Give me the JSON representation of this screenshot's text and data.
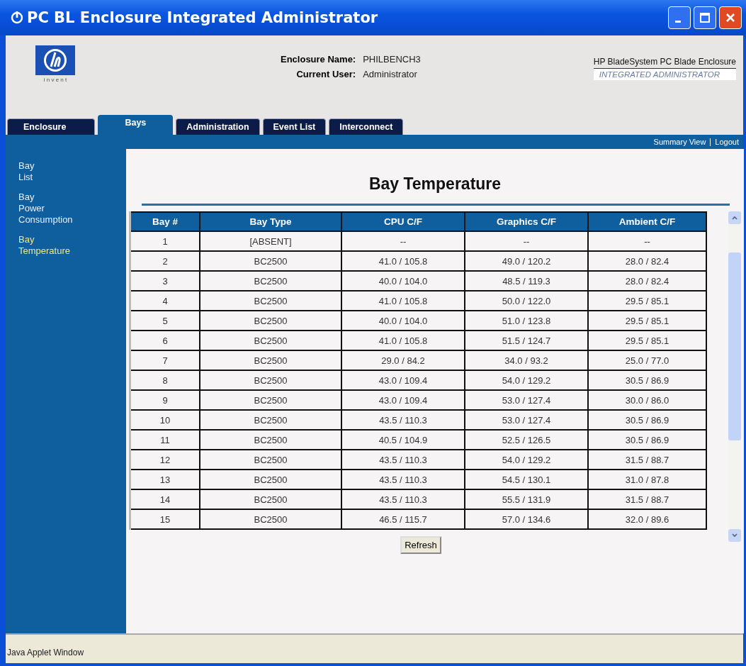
{
  "window": {
    "title": "PC BL Enclosure Integrated Administrator"
  },
  "header": {
    "fields": [
      {
        "label": "Enclosure Name:",
        "value": "PHILBENCH3"
      },
      {
        "label": "Current User:",
        "value": "Administrator"
      }
    ],
    "product_line_1": "HP BladeSystem PC Blade Enclosure",
    "product_line_2": "INTEGRATED ADMINISTRATOR",
    "logo_tagline": "i n v e n t"
  },
  "tabs": [
    {
      "label": "Enclosure",
      "selected": false
    },
    {
      "label": "Bays",
      "selected": true
    },
    {
      "label": "Administration",
      "selected": false
    },
    {
      "label": "Event List",
      "selected": false
    },
    {
      "label": "Interconnect",
      "selected": false
    }
  ],
  "top_links": [
    "Summary View",
    "Logout"
  ],
  "sidebar": {
    "items": [
      {
        "label": "Bay List",
        "selected": false
      },
      {
        "label": "Bay Power Consumption",
        "selected": false
      },
      {
        "label": "Bay Temperature",
        "selected": true
      }
    ]
  },
  "page_title": "Bay Temperature",
  "table": {
    "columns": [
      "Bay #",
      "Bay Type",
      "CPU C/F",
      "Graphics C/F",
      "Ambient C/F"
    ],
    "rows": [
      [
        "1",
        "[ABSENT]",
        "--",
        "--",
        "--"
      ],
      [
        "2",
        "BC2500",
        "41.0 / 105.8",
        "49.0 / 120.2",
        "28.0 / 82.4"
      ],
      [
        "3",
        "BC2500",
        "40.0 / 104.0",
        "48.5 / 119.3",
        "28.0 / 82.4"
      ],
      [
        "4",
        "BC2500",
        "41.0 / 105.8",
        "50.0 / 122.0",
        "29.5 / 85.1"
      ],
      [
        "5",
        "BC2500",
        "40.0 / 104.0",
        "51.0 / 123.8",
        "29.5 / 85.1"
      ],
      [
        "6",
        "BC2500",
        "41.0 / 105.8",
        "51.5 / 124.7",
        "29.5 / 85.1"
      ],
      [
        "7",
        "BC2500",
        "29.0 / 84.2",
        "34.0 / 93.2",
        "25.0 / 77.0"
      ],
      [
        "8",
        "BC2500",
        "43.0 / 109.4",
        "54.0 / 129.2",
        "30.5 / 86.9"
      ],
      [
        "9",
        "BC2500",
        "43.0 / 109.4",
        "53.0 / 127.4",
        "30.0 / 86.0"
      ],
      [
        "10",
        "BC2500",
        "43.5 / 110.3",
        "53.0 / 127.4",
        "30.5 / 86.9"
      ],
      [
        "11",
        "BC2500",
        "40.5 / 104.9",
        "52.5 / 126.5",
        "30.5 / 86.9"
      ],
      [
        "12",
        "BC2500",
        "43.5 / 110.3",
        "54.0 / 129.2",
        "31.5 / 88.7"
      ],
      [
        "13",
        "BC2500",
        "43.5 / 110.3",
        "54.5 / 130.1",
        "31.0 / 87.8"
      ],
      [
        "14",
        "BC2500",
        "43.5 / 110.3",
        "55.5 / 131.9",
        "31.5 / 88.7"
      ],
      [
        "15",
        "BC2500",
        "46.5 / 115.7",
        "57.0 / 134.6",
        "32.0 / 89.6"
      ]
    ]
  },
  "refresh_button": "Refresh",
  "status_bar": "Java Applet Window"
}
